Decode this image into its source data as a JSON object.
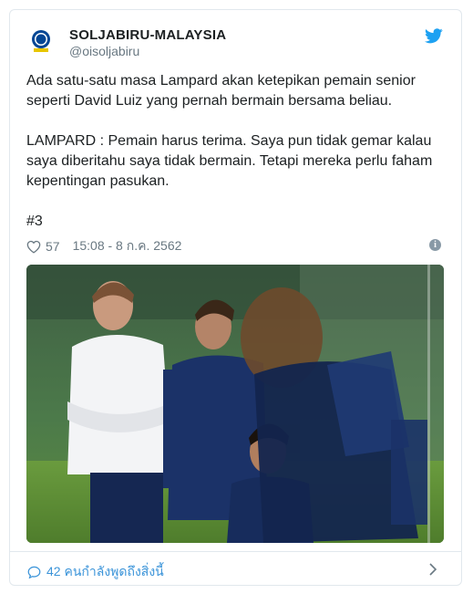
{
  "account": {
    "name": "SOLJABIRU-MALAYSIA",
    "handle": "@oisoljabiru"
  },
  "tweet": {
    "paragraph1": "Ada satu-satu masa Lampard akan ketepikan pemain senior seperti David Luiz yang pernah bermain bersama beliau.",
    "paragraph2": "LAMPARD : Pemain harus terima. Saya pun tidak gemar kalau saya diberitahu saya tidak bermain. Tetapi mereka perlu faham kepentingan pasukan.",
    "hashtag": "#3"
  },
  "meta": {
    "likes": "57",
    "timestamp": "15:08 - 8 ก.ค. 2562"
  },
  "footer": {
    "reply_text": "42 คนกำลังพูดถึงสิ่งนี้"
  },
  "icons": {
    "twitter_bird": "twitter-bird-icon",
    "heart": "heart-icon",
    "info": "info-icon",
    "reply": "reply-bubble-icon",
    "chevron": "chevron-right-icon"
  },
  "colors": {
    "twitter_blue": "#1da1f2",
    "link_blue": "#3b94d9",
    "muted": "#697882",
    "border": "#e1e8ed"
  }
}
